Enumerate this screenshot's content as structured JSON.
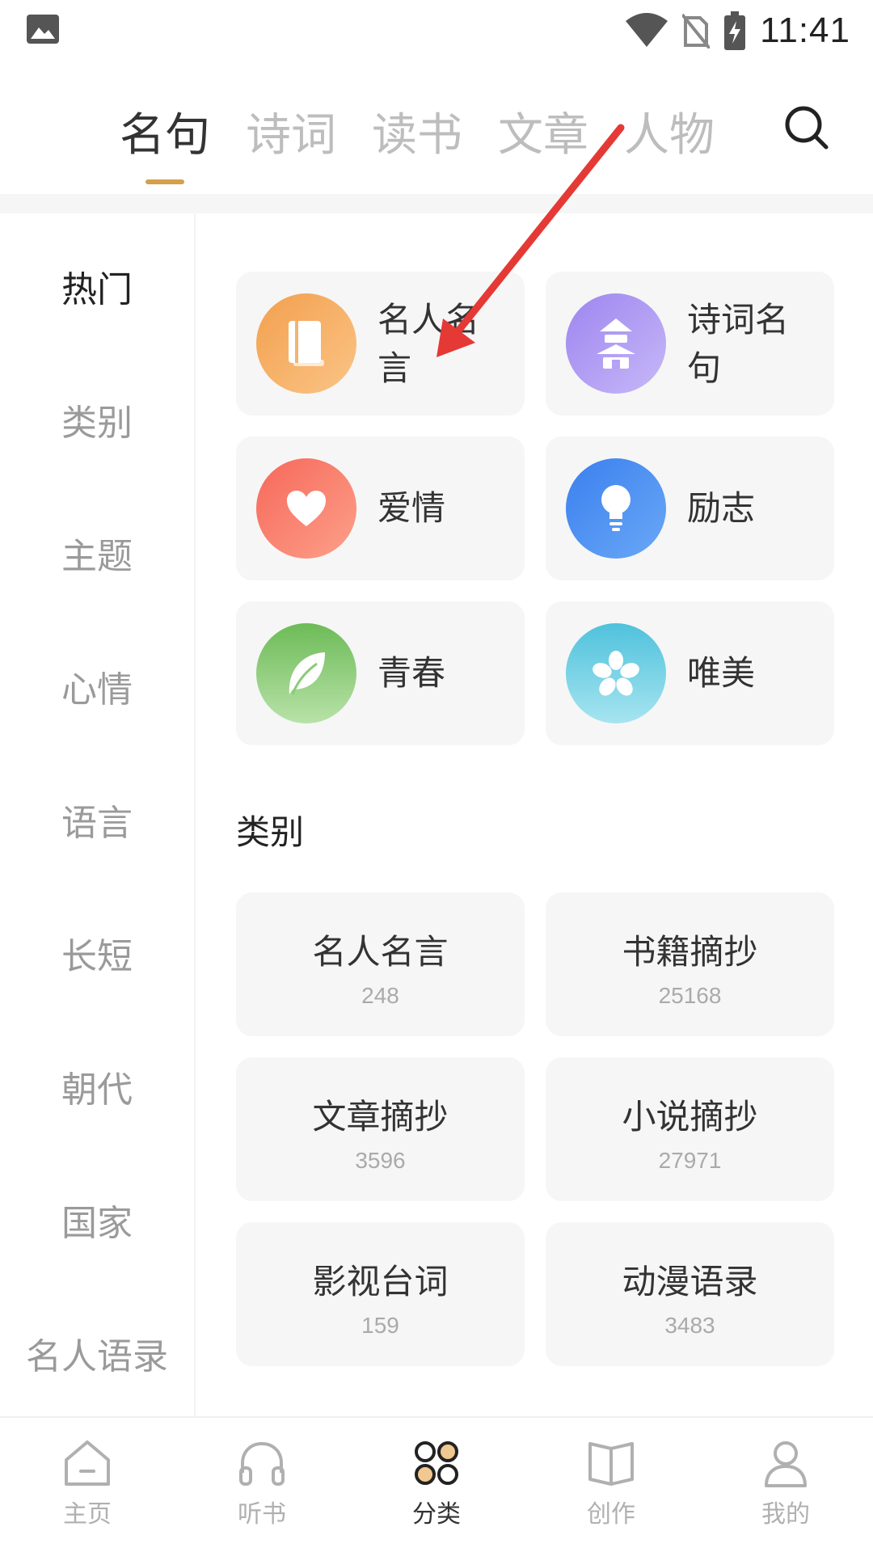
{
  "status_bar": {
    "time": "11:41"
  },
  "top_tabs": [
    {
      "label": "名句",
      "active": true
    },
    {
      "label": "诗词",
      "active": false
    },
    {
      "label": "读书",
      "active": false
    },
    {
      "label": "文章",
      "active": false
    },
    {
      "label": "人物",
      "active": false
    }
  ],
  "left_nav": [
    {
      "label": "热门",
      "active": true
    },
    {
      "label": "类别",
      "active": false
    },
    {
      "label": "主题",
      "active": false
    },
    {
      "label": "心情",
      "active": false
    },
    {
      "label": "语言",
      "active": false
    },
    {
      "label": "长短",
      "active": false
    },
    {
      "label": "朝代",
      "active": false
    },
    {
      "label": "国家",
      "active": false
    },
    {
      "label": "名人语录",
      "active": false
    }
  ],
  "hot_cards": [
    {
      "label": "名人名言",
      "icon": "book-icon",
      "color": "#f4a85c"
    },
    {
      "label": "诗词名句",
      "icon": "pagoda-icon",
      "color": "#a590f0"
    },
    {
      "label": "爱情",
      "icon": "heart-icon",
      "color": "#f87a6a"
    },
    {
      "label": "励志",
      "icon": "lightbulb-icon",
      "color": "#4a8cf0"
    },
    {
      "label": "青春",
      "icon": "leaf-icon",
      "color": "#7cc36a"
    },
    {
      "label": "唯美",
      "icon": "flower-icon",
      "color": "#5cc8de"
    }
  ],
  "category_section": {
    "title": "类别",
    "items": [
      {
        "name": "名人名言",
        "count": "248"
      },
      {
        "name": "书籍摘抄",
        "count": "25168"
      },
      {
        "name": "文章摘抄",
        "count": "3596"
      },
      {
        "name": "小说摘抄",
        "count": "27971"
      },
      {
        "name": "影视台词",
        "count": "159"
      },
      {
        "name": "动漫语录",
        "count": "3483"
      }
    ]
  },
  "bottom_nav": [
    {
      "label": "主页",
      "icon": "home-icon",
      "active": false
    },
    {
      "label": "听书",
      "icon": "headphones-icon",
      "active": false
    },
    {
      "label": "分类",
      "icon": "category-grid-icon",
      "active": true
    },
    {
      "label": "创作",
      "icon": "open-book-icon",
      "active": false
    },
    {
      "label": "我的",
      "icon": "user-icon",
      "active": false
    }
  ],
  "colors": {
    "accent": "#d4a04a",
    "annotation_arrow": "#e53935"
  }
}
